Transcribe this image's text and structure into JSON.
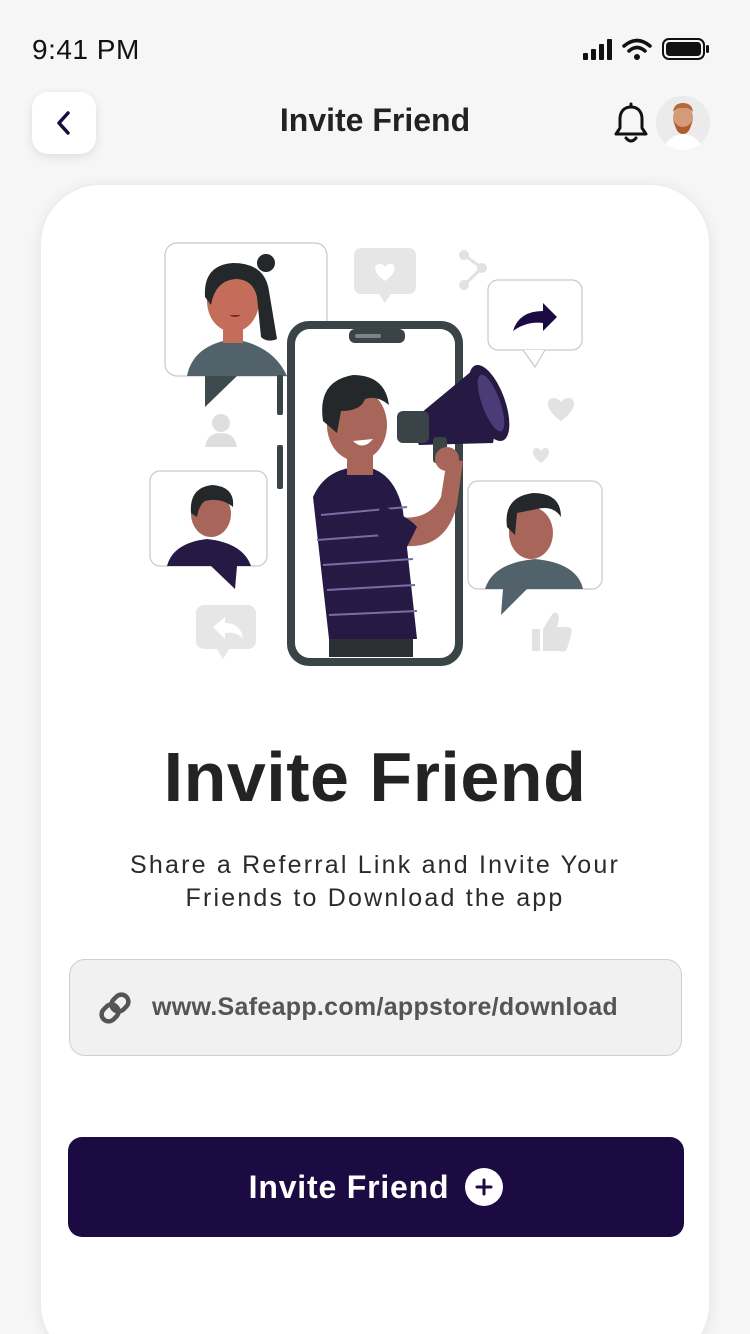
{
  "status_bar": {
    "time": "9:41 PM",
    "icons": [
      "signal-icon",
      "wifi-icon",
      "battery-icon"
    ]
  },
  "header": {
    "title": "Invite Friend",
    "icons": [
      "chevron-left-icon",
      "bell-icon"
    ]
  },
  "main": {
    "title": "Invite Friend",
    "subtitle_line1": "Share a Referral Link and Invite Your",
    "subtitle_line2": "Friends to Download the app",
    "referral_link": "www.Safeapp.com/appstore/download",
    "invite_button_label": "Invite Friend"
  },
  "colors": {
    "primary": "#1c0a42",
    "background": "#f6f6f7",
    "card": "#ffffff",
    "field": "#f1f1f1",
    "text": "#232323"
  }
}
